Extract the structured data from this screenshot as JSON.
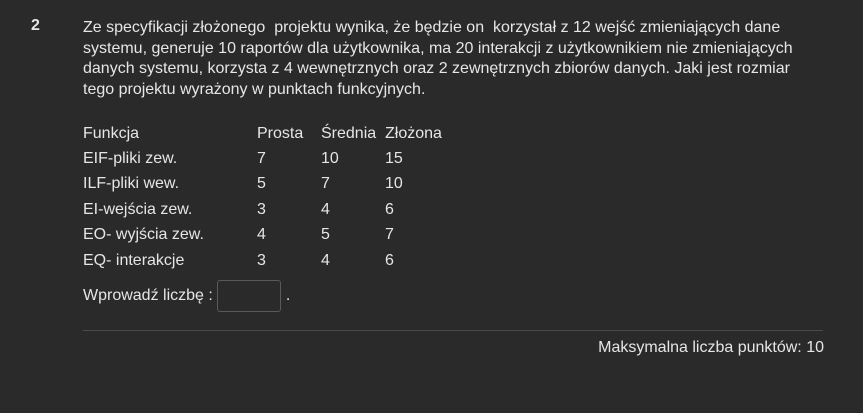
{
  "question": {
    "number": "2",
    "text_lines": [
      "Ze specyfikacji złożonego  projektu wynika, że będzie on  korzystał z 12 wejść zmieniających dane",
      "systemu, generuje 10 raportów dla użytkownika, ma 20 interakcji z użytkownikiem nie zmieniających",
      "danych systemu, korzysta z 4 wewnętrznych oraz 2 zewnętrznych zbiorów danych. Jaki jest rozmiar",
      "tego projektu wyrażony w punktach funkcyjnych."
    ]
  },
  "table": {
    "headers": [
      "Funkcja",
      "Prosta",
      "Średnia",
      "Złożona"
    ],
    "rows": [
      [
        "EIF-pliki zew.",
        "7",
        "10",
        "15"
      ],
      [
        "ILF-pliki wew.",
        "5",
        "7",
        "10"
      ],
      [
        "EI-wejścia zew.",
        "3",
        "4",
        "6"
      ],
      [
        "EO- wyjścia zew.",
        "4",
        "5",
        "7"
      ],
      [
        "EQ- interakcje",
        "3",
        "4",
        "6"
      ]
    ]
  },
  "answer": {
    "label": "Wprowadź liczbę :",
    "value": "",
    "suffix": "."
  },
  "footer": {
    "max_points": "Maksymalna liczba punktów: 10"
  }
}
